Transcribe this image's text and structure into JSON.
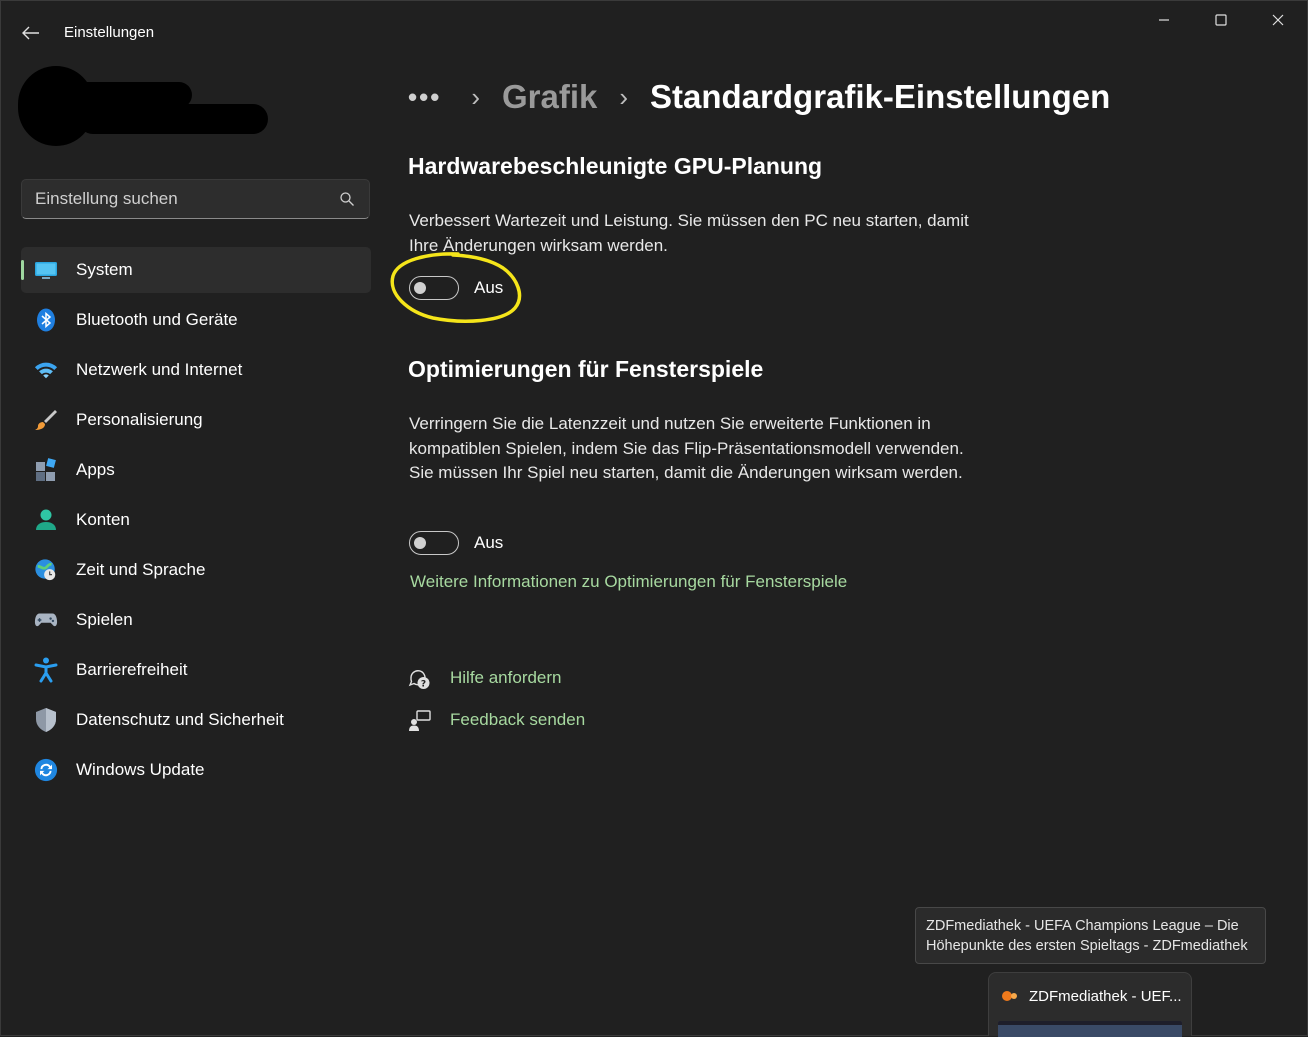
{
  "window": {
    "title": "Einstellungen"
  },
  "search": {
    "placeholder": "Einstellung suchen"
  },
  "sidebar": {
    "items": [
      {
        "label": "System",
        "icon": "system-icon",
        "active": true
      },
      {
        "label": "Bluetooth und Geräte",
        "icon": "bluetooth-icon"
      },
      {
        "label": "Netzwerk und Internet",
        "icon": "wifi-icon"
      },
      {
        "label": "Personalisierung",
        "icon": "brush-icon"
      },
      {
        "label": "Apps",
        "icon": "apps-icon"
      },
      {
        "label": "Konten",
        "icon": "account-icon"
      },
      {
        "label": "Zeit und Sprache",
        "icon": "globe-clock-icon"
      },
      {
        "label": "Spielen",
        "icon": "gamepad-icon"
      },
      {
        "label": "Barrierefreiheit",
        "icon": "accessibility-icon"
      },
      {
        "label": "Datenschutz und Sicherheit",
        "icon": "shield-icon"
      },
      {
        "label": "Windows Update",
        "icon": "update-icon"
      }
    ]
  },
  "breadcrumb": {
    "more": "•••",
    "parent": "Grafik",
    "current": "Standardgrafik-Einstellungen"
  },
  "gpu_scheduling": {
    "heading": "Hardwarebeschleunigte GPU-Planung",
    "description": "Verbessert Wartezeit und Leistung. Sie müssen den PC neu starten, damit Ihre Änderungen wirksam werden.",
    "toggle_state": "Aus"
  },
  "windowed_games": {
    "heading": "Optimierungen für Fensterspiele",
    "description": "Verringern Sie die Latenzzeit und nutzen Sie erweiterte Funktionen in kompatiblen Spielen, indem Sie das Flip-Präsentationsmodell verwenden. Sie müssen Ihr Spiel neu starten, damit die Änderungen wirksam werden.",
    "toggle_state": "Aus",
    "more_info_link": "Weitere Informationen zu Optimierungen für Fensterspiele"
  },
  "help": {
    "get_help": "Hilfe anfordern",
    "feedback": "Feedback senden"
  },
  "tooltip": {
    "text": "ZDFmediathek - UEFA Champions League – Die Höhepunkte des ersten Spieltags - ZDFmediathek"
  },
  "taskbar_preview": {
    "title": "ZDFmediathek - UEF..."
  },
  "colors": {
    "background": "#202020",
    "accent_green": "#a7d9a0",
    "annotation_yellow": "#f5e51a"
  }
}
